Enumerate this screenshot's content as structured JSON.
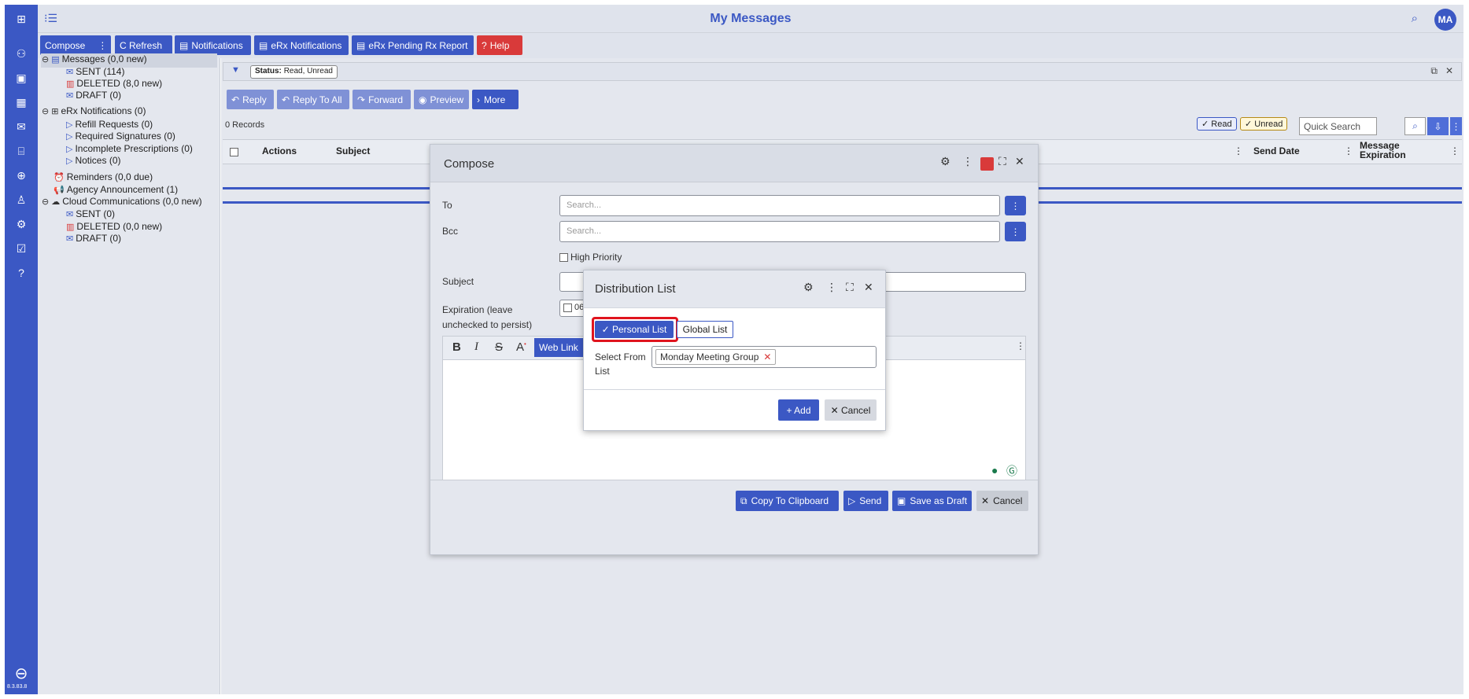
{
  "app": {
    "title": "My Messages",
    "avatar_initials": "MA",
    "version": "8.3.83.8"
  },
  "sidebar": {
    "icons": [
      "grid-icon",
      "sitemap-icon",
      "contact-card-icon",
      "calendar-icon",
      "mail-icon",
      "building-icon",
      "medical-case-icon",
      "person-icon",
      "settings-icon",
      "checklist-icon",
      "help-icon",
      "logout-icon"
    ]
  },
  "toolbar": {
    "compose": "Compose",
    "more_dots": "⋮",
    "refresh": "C Refresh",
    "notifications": "Notifications",
    "erx_notifications": "eRx Notifications",
    "erx_pending": "eRx Pending Rx Report",
    "help": "Help"
  },
  "tree": {
    "messages": "Messages (0,0 new)",
    "sent": "SENT (114)",
    "deleted": "DELETED (8,0 new)",
    "draft": "DRAFT (0)",
    "erx": "eRx Notifications (0)",
    "refill": "Refill Requests (0)",
    "required_sig": "Required Signatures (0)",
    "incomplete": "Incomplete Prescriptions (0)",
    "notices": "Notices (0)",
    "reminders": "Reminders (0,0 due)",
    "agency": "Agency Announcement (1)",
    "cloud": "Cloud Communications (0,0 new)",
    "cloud_sent": "SENT (0)",
    "cloud_deleted": "DELETED (0,0 new)",
    "cloud_draft": "DRAFT (0)"
  },
  "filter": {
    "status_label": "Status:",
    "status_value": "Read, Unread"
  },
  "actions": {
    "reply": "Reply",
    "reply_all": "Reply To All",
    "forward": "Forward",
    "preview": "Preview",
    "more": "More"
  },
  "list": {
    "records": "0 Records",
    "read_chip": "✓ Read",
    "unread_chip": "✓ Unread",
    "quick_search_placeholder": "Quick Search",
    "columns": {
      "actions": "Actions",
      "subject": "Subject",
      "send_date": "Send Date",
      "expiration": "Message Expiration"
    }
  },
  "compose": {
    "title": "Compose",
    "to_label": "To",
    "to_placeholder": "Search...",
    "bcc_label": "Bcc",
    "bcc_placeholder": "Search...",
    "high_priority": "High Priority",
    "subject_label": "Subject",
    "expiration_label": "Expiration (leave unchecked to persist)",
    "expiration_value": "06",
    "web_link": "Web Link",
    "footer": {
      "copy": "Copy To Clipboard",
      "send": "Send",
      "save_draft": "Save as Draft",
      "cancel": "Cancel"
    }
  },
  "distribution": {
    "title": "Distribution List",
    "personal": "✓ Personal List",
    "global": "Global List",
    "select_label": "Select From List",
    "selected": "Monday Meeting Group",
    "add": "+ Add",
    "cancel": "✕ Cancel"
  },
  "colors": {
    "brand": "#3b58c4",
    "danger": "#d93a3a",
    "highlight": "#e0141e"
  }
}
